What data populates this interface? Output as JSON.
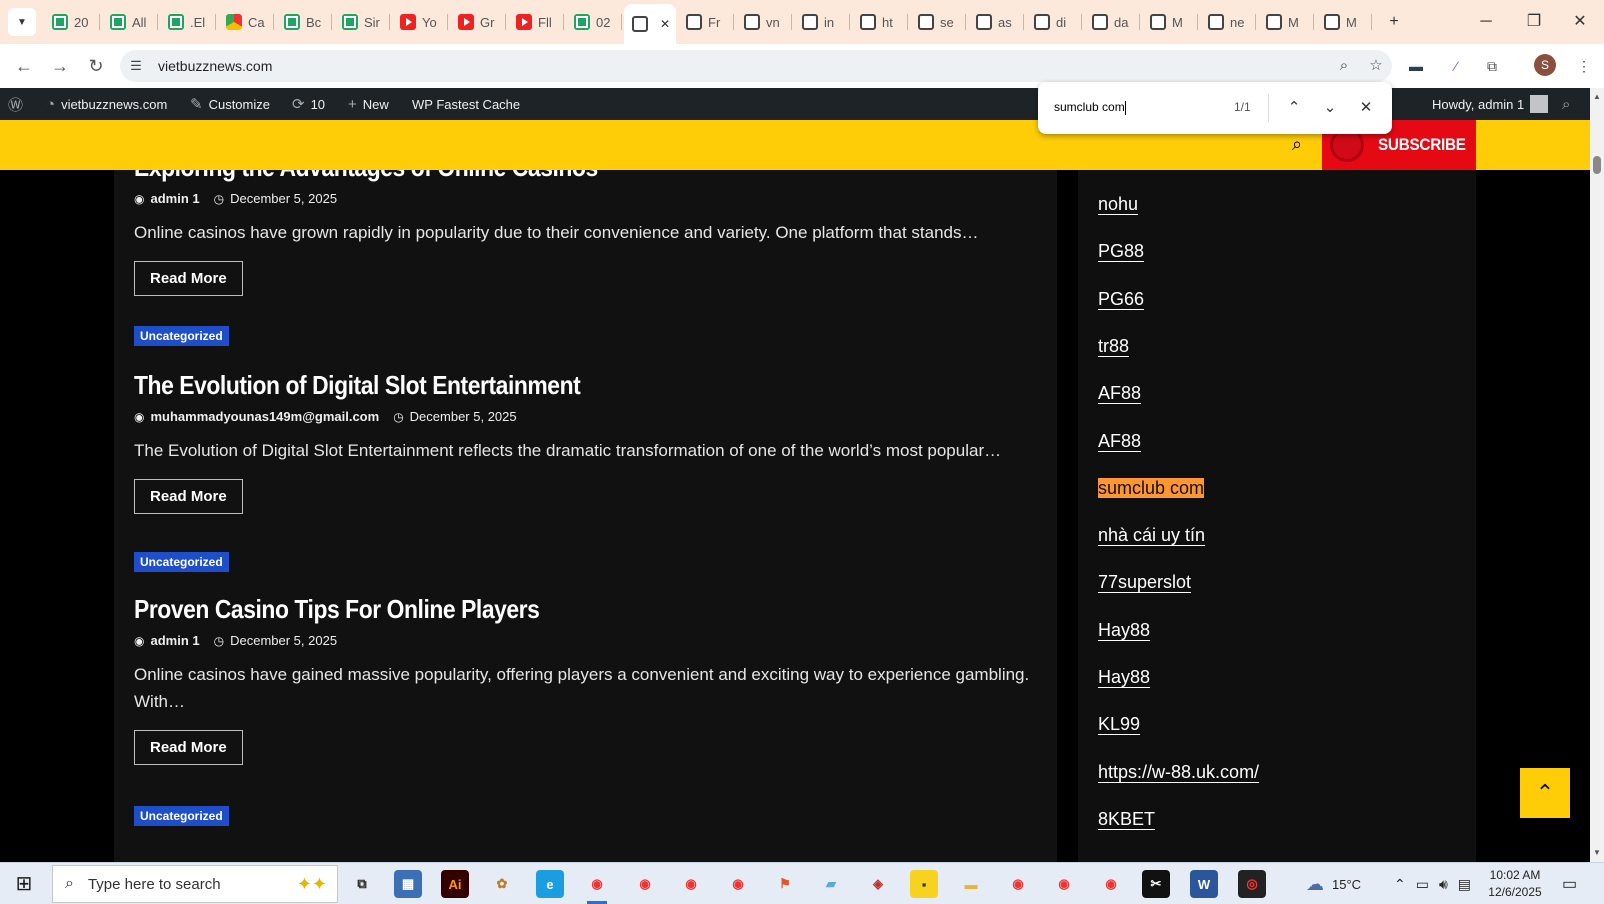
{
  "tabs": [
    {
      "label": "20",
      "icon": "sheets-icon"
    },
    {
      "label": "All",
      "icon": "sheets-icon"
    },
    {
      "label": ".El",
      "icon": "sheets-icon"
    },
    {
      "label": "Ca",
      "icon": "chrome-icon"
    },
    {
      "label": "Bc",
      "icon": "sheets-icon"
    },
    {
      "label": "Sir",
      "icon": "sheets-icon"
    },
    {
      "label": "Yo",
      "icon": "youtube-icon"
    },
    {
      "label": "Gr",
      "icon": "youtube-icon"
    },
    {
      "label": "Fll",
      "icon": "youtube-icon"
    },
    {
      "label": "02",
      "icon": "sheets-icon"
    },
    {
      "label": "",
      "icon": "globe-icon",
      "active": true
    },
    {
      "label": "Fr",
      "icon": "globe-icon"
    },
    {
      "label": "vn",
      "icon": "globe-icon"
    },
    {
      "label": "in",
      "icon": "globe-icon"
    },
    {
      "label": "ht",
      "icon": "globe-icon"
    },
    {
      "label": "se",
      "icon": "globe-icon"
    },
    {
      "label": "as",
      "icon": "globe-icon"
    },
    {
      "label": "di",
      "icon": "globe-icon"
    },
    {
      "label": "da",
      "icon": "globe-icon"
    },
    {
      "label": "M",
      "icon": "globe-icon"
    },
    {
      "label": "ne",
      "icon": "globe-icon"
    },
    {
      "label": "M",
      "icon": "globe-icon"
    },
    {
      "label": "M",
      "icon": "globe-icon"
    }
  ],
  "address": {
    "url": "vietbuzznews.com"
  },
  "wpbar": {
    "site": "vietbuzznews.com",
    "customize": "Customize",
    "updates": "10",
    "new": "New",
    "cache": "WP Fastest Cache",
    "howdy": "Howdy, admin 1"
  },
  "findbar": {
    "query": "sumclub com",
    "count": "1/1"
  },
  "header": {
    "subscribe": "SUBSCRIBE"
  },
  "posts": [
    {
      "title": "Exploring the Advantages of Online Casinos",
      "author": "admin 1",
      "date": "December 5, 2025",
      "excerpt": "Online casinos have grown rapidly in popularity due to their convenience and variety. One platform that stands…",
      "read_more": "Read More"
    },
    {
      "category": "Uncategorized",
      "title": "The Evolution of Digital Slot Entertainment",
      "author": "muhammadyounas149m@gmail.com",
      "date": "December 5, 2025",
      "excerpt": "The Evolution of Digital Slot Entertainment reflects the dramatic transformation of one of the world’s most popular…",
      "read_more": "Read More"
    },
    {
      "category": "Uncategorized",
      "title": "Proven Casino Tips For Online Players",
      "author": "admin 1",
      "date": "December 5, 2025",
      "excerpt": "Online casinos have gained massive popularity, offering players a convenient and exciting way to experience gambling. With…",
      "read_more": "Read More"
    }
  ],
  "first_category": "Uncategorized",
  "bottom_category": "Uncategorized",
  "sidebar_links": [
    "nohu",
    "PG88",
    "PG66",
    "tr88",
    "AF88",
    "AF88",
    "sumclub com",
    "nhà cái uy tín",
    "77superslot",
    "Hay88",
    "Hay88",
    "KL99",
    "https://w-88.uk.com/",
    "8KBET"
  ],
  "taskbar": {
    "search_placeholder": "Type here to search",
    "weather": "15°C",
    "time": "10:02 AM",
    "date": "12/6/2025"
  },
  "colors": {
    "header": "#fecd07",
    "subscribe": "#e50914",
    "category": "#1e4fc9",
    "find_highlight": "#ff9632"
  }
}
